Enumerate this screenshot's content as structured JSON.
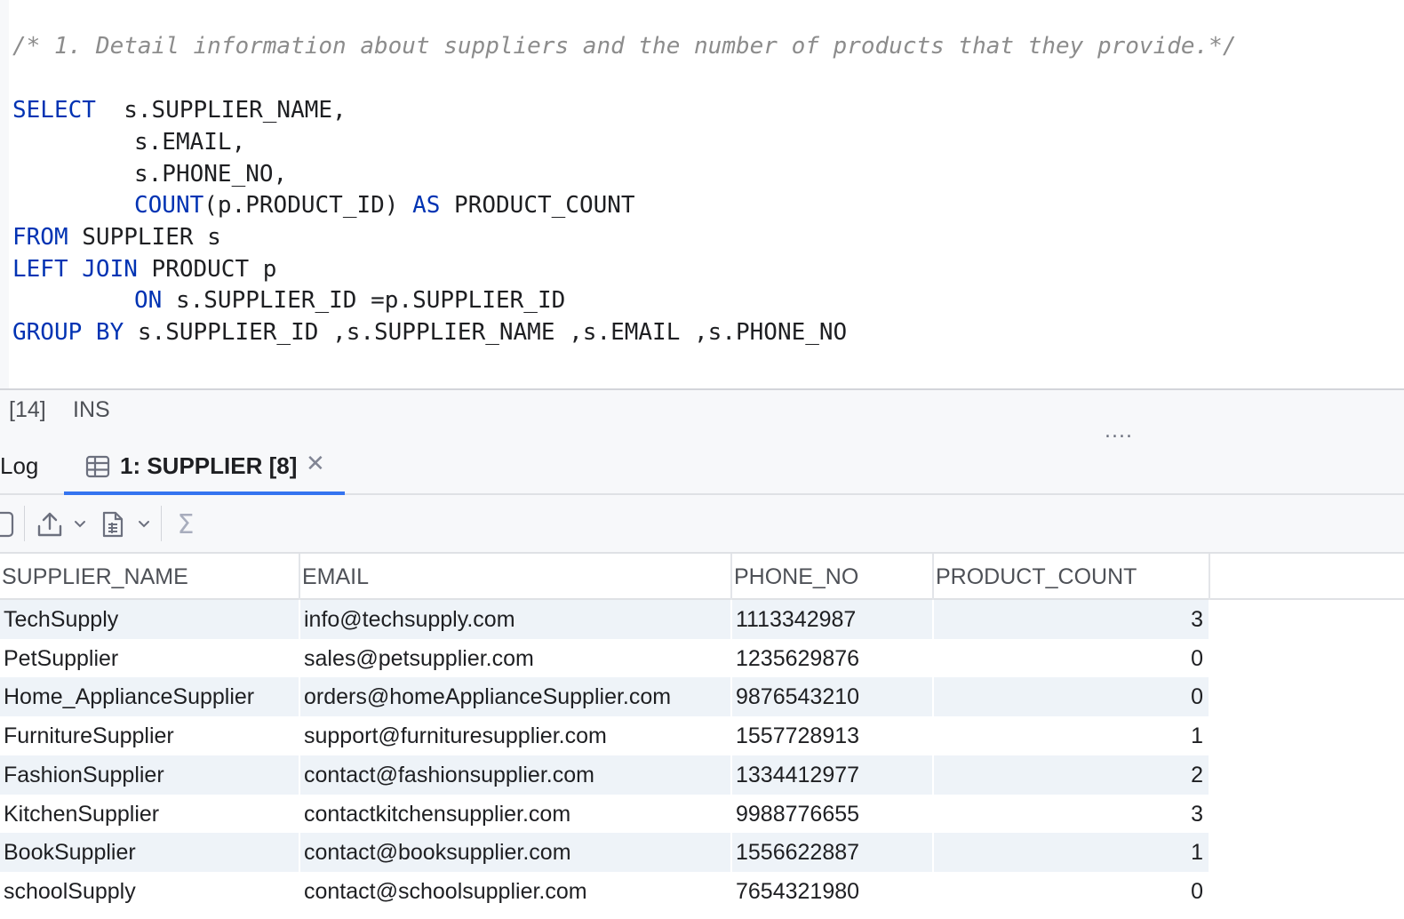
{
  "editor": {
    "comment": "/* 1. Detail information about suppliers and the number of products that they provide.*/",
    "lines": [
      {
        "kw": "SELECT",
        "rest": "  s.SUPPLIER_NAME,"
      },
      {
        "kw": "",
        "rest": "s.EMAIL,"
      },
      {
        "kw": "",
        "rest": "s.PHONE_NO,"
      },
      {
        "kw": "COUNT",
        "rest": "(p.PRODUCT_ID) ",
        "kw2": "AS",
        "rest2": " PRODUCT_COUNT"
      },
      {
        "kw": "FROM",
        "rest": " SUPPLIER s"
      },
      {
        "kw": "LEFT JOIN",
        "rest": " PRODUCT p"
      },
      {
        "kw": "ON",
        "rest": " s.SUPPLIER_ID =p.SUPPLIER_ID"
      },
      {
        "kw": "GROUP BY",
        "rest": " s.SUPPLIER_ID ,s.SUPPLIER_NAME ,s.EMAIL ,s.PHONE_NO"
      }
    ]
  },
  "status": {
    "position": "[14]",
    "mode": "INS"
  },
  "panel": {
    "drag_handle": "....",
    "tabs": {
      "log": "Log",
      "active": "1: SUPPLIER [8]",
      "active_icon": "table-icon",
      "close_icon": "close-icon"
    },
    "toolbar": {
      "items": [
        "stop-icon",
        "export-icon",
        "chevron-down-icon",
        "document-icon",
        "chevron-down-icon",
        "sigma-icon"
      ],
      "sigma": "Σ"
    }
  },
  "grid": {
    "columns": [
      "SUPPLIER_NAME",
      "EMAIL",
      "PHONE_NO",
      "PRODUCT_COUNT"
    ],
    "rows": [
      [
        "TechSupply",
        "info@techsupply.com",
        "1113342987",
        "3"
      ],
      [
        "PetSupplier",
        "sales@petsupplier.com",
        "1235629876",
        "0"
      ],
      [
        "Home_ApplianceSupplier",
        "orders@homeApplianceSupplier.com",
        "9876543210",
        "0"
      ],
      [
        "FurnitureSupplier",
        "support@furnituresupplier.com",
        "1557728913",
        "1"
      ],
      [
        "FashionSupplier",
        "contact@fashionsupplier.com",
        "1334412977",
        "2"
      ],
      [
        "KitchenSupplier",
        "contactkitchensupplier.com",
        "9988776655",
        "3"
      ],
      [
        "BookSupplier",
        "contact@booksupplier.com",
        "1556622887",
        "1"
      ],
      [
        "schoolSupply",
        "contact@schoolsupplier.com",
        "7654321980",
        "0"
      ]
    ]
  },
  "colors": {
    "keyword": "#0033b3",
    "comment": "#8c8c8c",
    "accent": "#3574f0",
    "stripe": "#eef3f8"
  }
}
